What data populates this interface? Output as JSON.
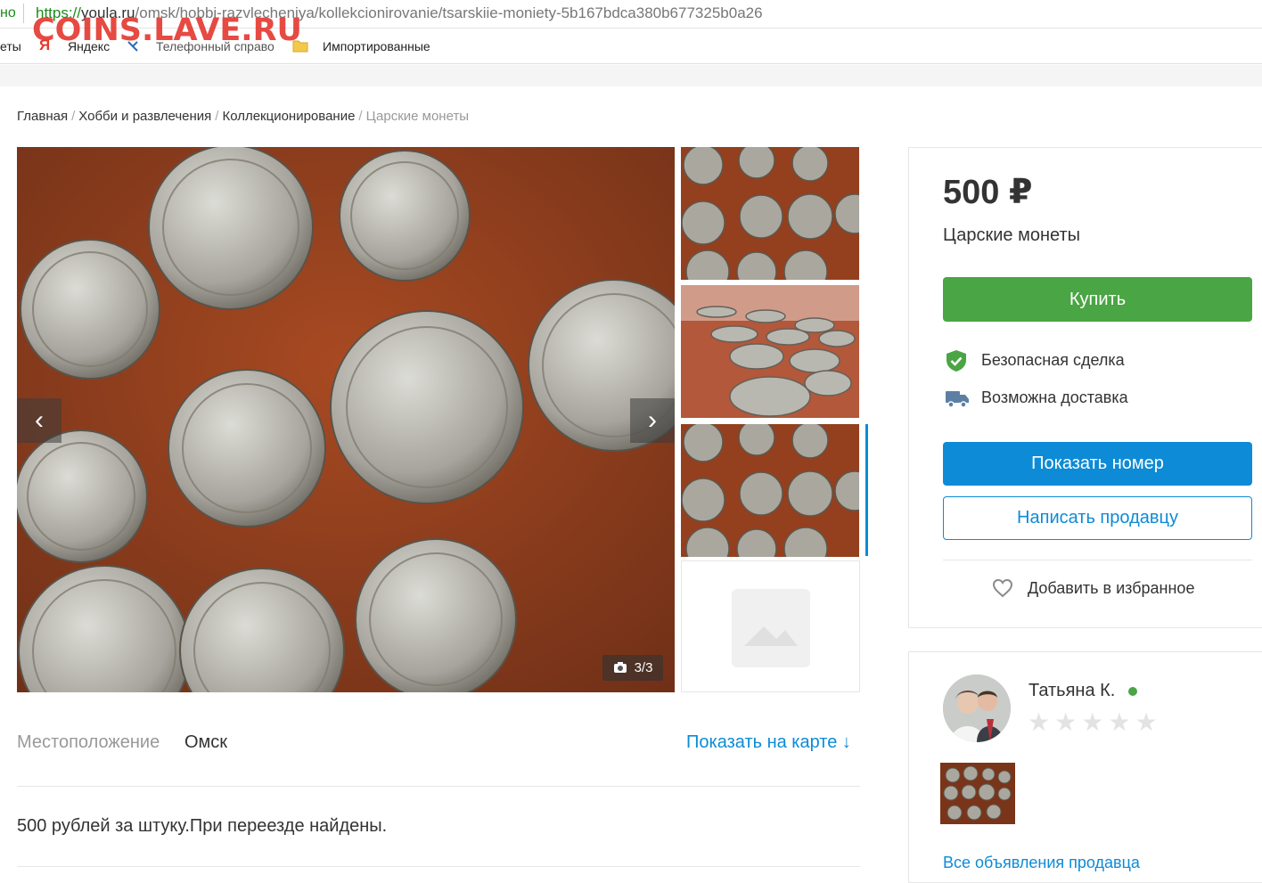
{
  "browser": {
    "security_text": "но",
    "url_scheme": "https://",
    "url_host": "youla.ru",
    "url_path": "/omsk/hobbi-razvlecheniya/kollekcionirovanie/tsarskiie-moniety-5b167bdca380b677325b0a26",
    "bookmarks": [
      {
        "label": "еты",
        "icon": "bookmark-fragment"
      },
      {
        "label": "Яндекс",
        "icon": "yandex-icon"
      },
      {
        "label": "Телефонный справо",
        "icon": "phone-tool-icon"
      },
      {
        "label": "Импортированные",
        "icon": "folder-icon"
      }
    ],
    "watermark": "COINS.LAVE.RU"
  },
  "breadcrumbs": [
    "Главная",
    "Хобби и развлечения",
    "Коллекционирование",
    "Царские монеты"
  ],
  "gallery": {
    "counter": "3/3",
    "prev_icon": "chevron-left-icon",
    "next_icon": "chevron-right-icon",
    "active_index": 3
  },
  "location": {
    "label": "Местоположение",
    "value": "Омск",
    "map_link": "Показать на карте ↓"
  },
  "description": "500 рублей за штуку.При переезде найдены.",
  "offer": {
    "price": "500 ₽",
    "title": "Царские монеты",
    "buy_label": "Купить",
    "features": [
      {
        "icon": "shield-check-icon",
        "label": "Безопасная сделка"
      },
      {
        "icon": "truck-icon",
        "label": "Возможна доставка"
      }
    ],
    "show_phone_label": "Показать номер",
    "write_label": "Написать продавцу",
    "favorite_label": "Добавить в избранное"
  },
  "seller": {
    "name": "Татьяна К.",
    "online": true,
    "rating": 0,
    "rating_max": 5,
    "all_ads_label": "Все объявления продавца"
  },
  "colors": {
    "accent_blue": "#0d8bd6",
    "buy_green": "#4aa544",
    "online_green": "#4aa544"
  }
}
